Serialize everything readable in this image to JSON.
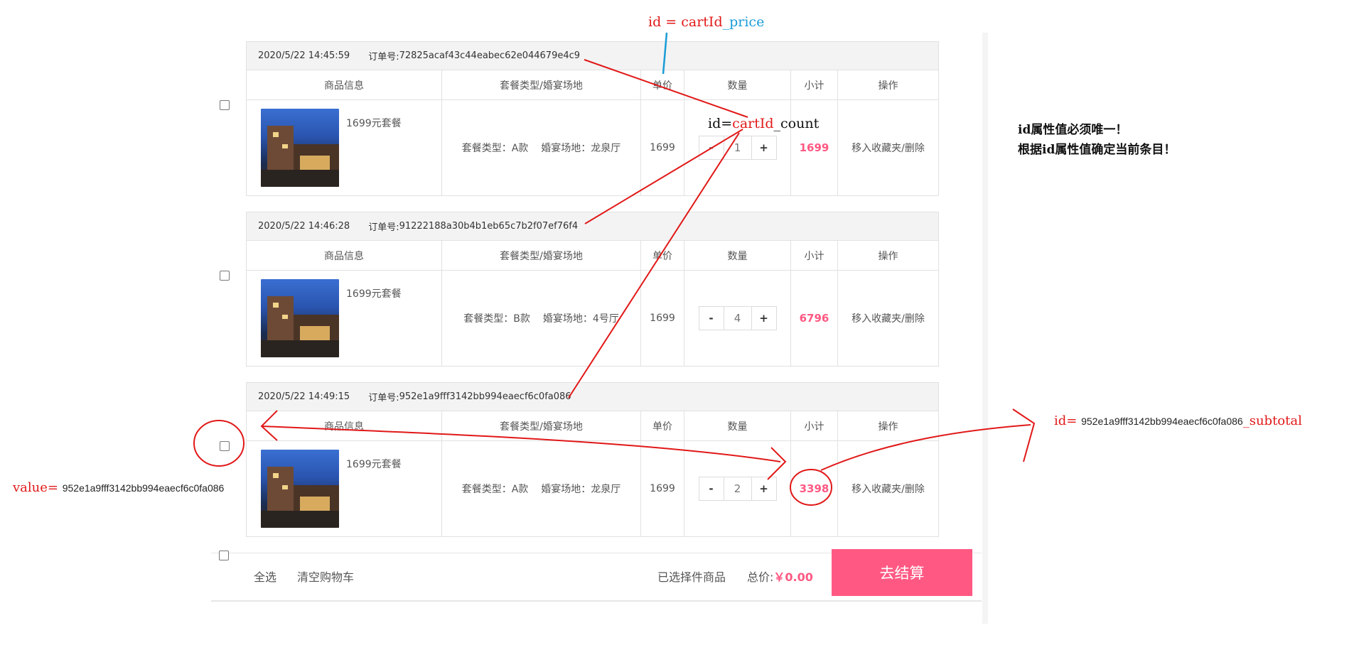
{
  "orders": [
    {
      "time": "2020/5/22 14:45:59",
      "order_label": "订单号:",
      "order_no": "72825acaf43c44eabec62e044679e4c9",
      "headers": [
        "商品信息",
        "套餐类型/婚宴场地",
        "单价",
        "数量",
        "小计",
        "操作"
      ],
      "product_name": "1699元套餐",
      "package_type": "套餐类型：A款",
      "venue": "婚宴场地：龙泉厅",
      "price": "1699",
      "qty_minus": "-",
      "qty": "1",
      "qty_plus": "+",
      "subtotal": "1699",
      "action": "移入收藏夹/删除"
    },
    {
      "time": "2020/5/22 14:46:28",
      "order_label": "订单号:",
      "order_no": "91222188a30b4b1eb65c7b2f07ef76f4",
      "headers": [
        "商品信息",
        "套餐类型/婚宴场地",
        "单价",
        "数量",
        "小计",
        "操作"
      ],
      "product_name": "1699元套餐",
      "package_type": "套餐类型：B款",
      "venue": "婚宴场地：4号厅",
      "price": "1699",
      "qty_minus": "-",
      "qty": "4",
      "qty_plus": "+",
      "subtotal": "6796",
      "action": "移入收藏夹/删除"
    },
    {
      "time": "2020/5/22 14:49:15",
      "order_label": "订单号:",
      "order_no": "952e1a9fff3142bb994eaecf6c0fa086",
      "headers": [
        "商品信息",
        "套餐类型/婚宴场地",
        "单价",
        "数量",
        "小计",
        "操作"
      ],
      "product_name": "1699元套餐",
      "package_type": "套餐类型：A款",
      "venue": "婚宴场地：龙泉厅",
      "price": "1699",
      "qty_minus": "-",
      "qty": "2",
      "qty_plus": "+",
      "subtotal": "3398",
      "action": "移入收藏夹/删除"
    }
  ],
  "footer": {
    "select_all": "全选",
    "clear_cart": "清空购物车",
    "selected_items": "已选择件商品",
    "total_label": "总价:",
    "total_amount": "￥0.00",
    "checkout": "去结算"
  },
  "annotations": {
    "price_id_prefix": "id = ",
    "price_id_red": "cartId",
    "price_id_blue": "_price",
    "count_prefix": "id=",
    "count_red": "cartId",
    "count_suffix": "_count",
    "note_line1": "id属性值必须唯一！",
    "note_line2": "根据id属性值确定当前条目！",
    "subtotal_prefix": "id=",
    "subtotal_value": "952e1a9fff3142bb994eaecf6c0fa086",
    "subtotal_suffix": "_subtotal",
    "value_prefix": "value=",
    "value_value": "952e1a9fff3142bb994eaecf6c0fa086"
  },
  "colors": {
    "accent_pink": "#ff5983",
    "annotation_red": "#e11818",
    "annotation_blue": "#1a9bd6"
  }
}
